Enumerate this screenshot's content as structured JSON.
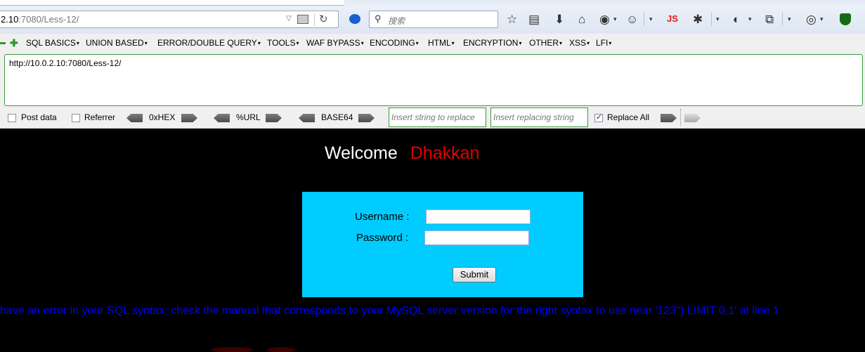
{
  "browser": {
    "url_prefix_gray": "",
    "url_host": "2.10",
    "url_rest": ":7080/Less-12/",
    "search_placeholder": "搜索",
    "js_label": "JS"
  },
  "hackbar": {
    "menu": [
      "SQL BASICS",
      "UNION BASED",
      "ERROR/DOUBLE QUERY",
      "TOOLS",
      "WAF BYPASS",
      "ENCODING",
      "HTML",
      "ENCRYPTION",
      "OTHER",
      "XSS",
      "LFI"
    ],
    "url_value": "http://10.0.2.10:7080/Less-12/",
    "post_data_label": "Post data",
    "referrer_label": "Referrer",
    "hex_label": "0xHEX",
    "url_enc_label": "%URL",
    "base64_label": "BASE64",
    "replace_placeholder": "Insert string to replace",
    "replacing_placeholder": "Insert replacing string",
    "replace_all_label": "Replace All",
    "post_data_checked": false,
    "referrer_checked": false,
    "replace_all_checked": true
  },
  "page": {
    "welcome": "Welcome",
    "name": "Dhakkan",
    "username_label": "Username :",
    "password_label": "Password :",
    "submit_label": "Submit",
    "error_message": "have an error in your SQL syntax; check the manual that corresponds to your MySQL server version for the right syntax to use near '123\") LIMIT 0,1' at line 1"
  }
}
